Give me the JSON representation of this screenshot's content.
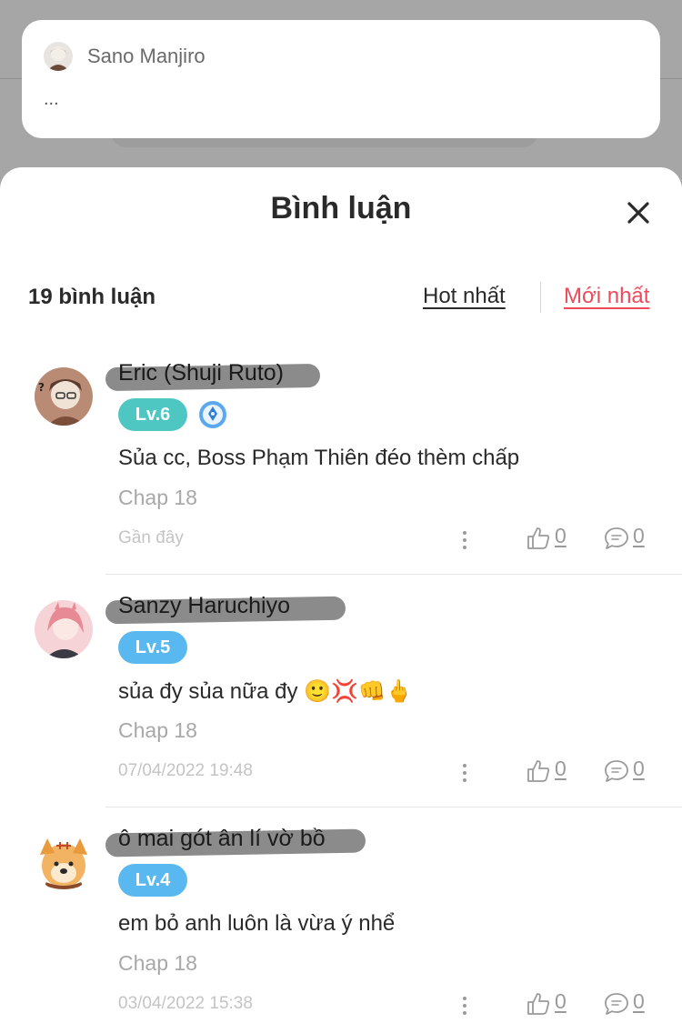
{
  "notification": {
    "author": "Sano Manjiro",
    "text": "..."
  },
  "sheet": {
    "title": "Bình luận",
    "comment_count": "19 bình luận",
    "sort_hot": "Hot nhất",
    "sort_new": "Mới nhất",
    "sort_active_color": "#ef4a5a"
  },
  "comments": [
    {
      "name": "Eric (Shuji Ruto)",
      "level": "Lv.6",
      "level_color": "#4ec7c3",
      "has_badge": true,
      "text": "Sủa cc, Boss Phạm Thiên đéo thèm chấp",
      "chapter": "Chap 18",
      "time": "Gần đây",
      "likes": "0",
      "replies": "0"
    },
    {
      "name": "Sanzy Haruchiyo",
      "level": "Lv.5",
      "level_color": "#5ab8f0",
      "has_badge": false,
      "text": "sủa đy sủa nữa đy 🙂💢👊🖕",
      "chapter": "Chap 18",
      "time": "07/04/2022 19:48",
      "likes": "0",
      "replies": "0"
    },
    {
      "name": "ô mai gót ân lí vờ bồ",
      "level": "Lv.4",
      "level_color": "#5ab8f0",
      "has_badge": false,
      "text": "em bỏ anh luôn là vừa ý nhể",
      "chapter": "Chap 18",
      "time": "03/04/2022 15:38",
      "likes": "0",
      "replies": "0"
    }
  ]
}
